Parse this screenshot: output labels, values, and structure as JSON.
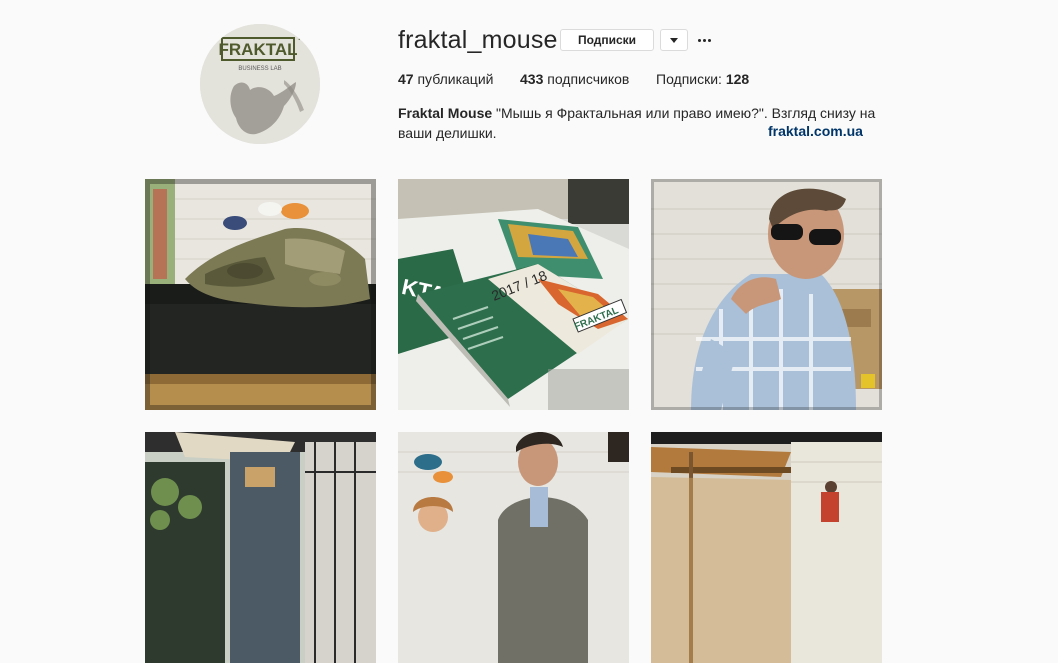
{
  "profile": {
    "username": "fraktal_mouse",
    "follow_label": "Подписки",
    "stats": {
      "posts_count": "47",
      "posts_label": " публикаций",
      "followers_count": "433",
      "followers_label": " подписчиков",
      "following_label": "Подписки: ",
      "following_count": "128"
    },
    "bio": {
      "name": "Fraktal Mouse",
      "text": " \"Мышь я Фрактальная или право имею?\". Взгляд снизу на ваши делишки.",
      "link": "fraktal.com.ua"
    },
    "avatar_logo": {
      "brand": "FRAKTAL",
      "sub": "BUSINESS LAB"
    }
  },
  "icons": {
    "dropdown": "chevron-down-icon",
    "more": "more-horizontal-icon"
  },
  "photos": [
    {
      "description": "camouflage-jacket-on-sofa"
    },
    {
      "description": "fraktal-booklets-on-table"
    },
    {
      "description": "man-in-sunglasses"
    },
    {
      "description": "building-entrance-with-sign"
    },
    {
      "description": "people-in-workshop"
    },
    {
      "description": "wooden-workshop-interior"
    }
  ]
}
